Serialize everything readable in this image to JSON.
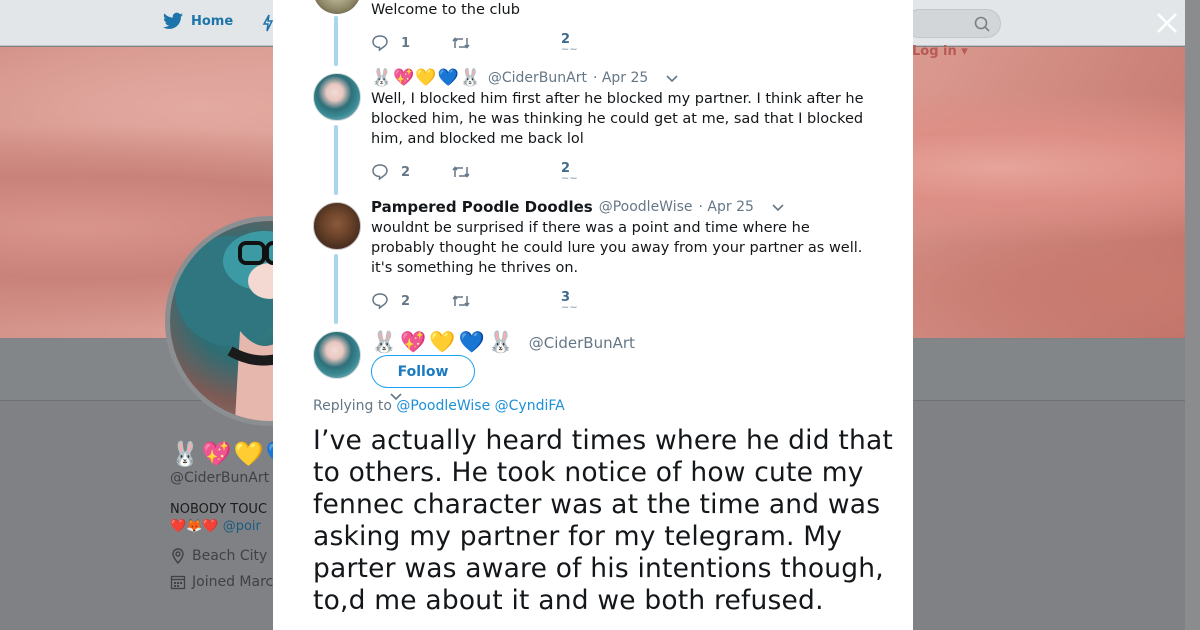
{
  "nav": {
    "home_label": "Home",
    "login_label": "Log in"
  },
  "background_profile": {
    "emojis": "🐰💖💛💙",
    "handle": "@CiderBunArt",
    "bio_line1": "NOBODY TOUC",
    "bio_line2_emojis": "❤️🦊❤️",
    "bio_line2_link": "@poir",
    "location": "Beach City",
    "joined": "Joined Marc"
  },
  "modal": {
    "tweets": [
      {
        "text": "Welcome to the club",
        "replies": "1",
        "likes": "2"
      },
      {
        "name_emojis": "🐰💖💛💙🐰",
        "handle": "@CiderBunArt",
        "date": "· Apr 25",
        "text": "Well, I blocked him first after he blocked my partner. I think after he blocked him, he was thinking he could get at me, sad that I blocked him, and blocked me back lol",
        "replies": "2",
        "likes": "2"
      },
      {
        "name": "Pampered Poodle Doodles",
        "handle": "@PoodleWise",
        "date": "· Apr 25",
        "text": "wouldnt be surprised if there was a point and time where he probably thought he could lure you away from your partner as well. it's something he thrives on.",
        "replies": "2",
        "likes": "3"
      }
    ],
    "main_tweet": {
      "name_emojis": "🐰💖💛💙🐰",
      "handle": "@CiderBunArt",
      "follow_label": "Follow",
      "replying_prefix": "Replying to",
      "mention1": "@PoodleWise",
      "mention2": "@CyndiFA",
      "text": "I’ve actually heard times where he did that to others. He took notice of how cute my fennec character was at the time and was asking my partner for my telegram. My parter was aware of his intentions though, to,d me about it and we both refused."
    }
  },
  "icons": {
    "close": "close-icon",
    "reply": "reply-icon",
    "retweet": "retweet-icon",
    "caret": "chevron-down-icon",
    "search": "search-icon"
  },
  "colors": {
    "accent": "#1da1f2",
    "thread_line": "#a7d6f0",
    "muted": "#657786"
  }
}
